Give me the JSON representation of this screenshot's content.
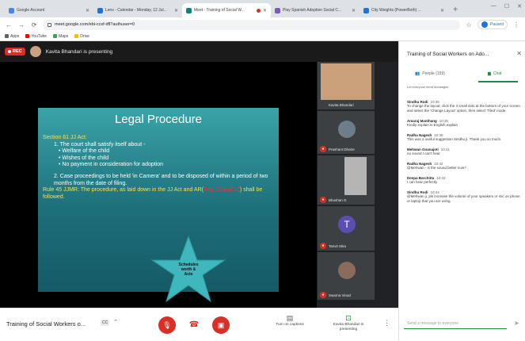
{
  "browser": {
    "tabs": [
      {
        "title": "Google Account",
        "color": "#4285f4",
        "active": false
      },
      {
        "title": "Lens - Calendar - Monday, 12 Jul...",
        "color": "#1a73e8",
        "active": false
      },
      {
        "title": "Meet - Training of Social W...",
        "color": "#00897b",
        "active": true
      },
      {
        "title": "Play Spanish Adoption Social C...",
        "color": "#7e57c2",
        "active": false
      },
      {
        "title": "City Weights (PowerBoth) ...",
        "color": "#1a73e8",
        "active": false
      }
    ],
    "url": "meet.google.com/ebi-ccsf-dfl?authuser=0",
    "paused_label": "Paused",
    "bookmarks": [
      {
        "label": "Apps",
        "color": "#5f6368"
      },
      {
        "label": "YouTube",
        "color": "#ff0000"
      },
      {
        "label": "Maps",
        "color": "#34a853"
      },
      {
        "label": "Drive",
        "color": "#fbbc04"
      }
    ]
  },
  "meet": {
    "rec_label": "REC",
    "presenting_text": "Kavita Bhandari is presenting",
    "slide": {
      "title": "Legal Procedure",
      "lines": [
        {
          "text": "Section 61 JJ Act:",
          "style": "yl"
        },
        {
          "text": "1. The court shall satisfy itself about -",
          "style": "ind1"
        },
        {
          "text": "• Welfare of the child",
          "style": "ind2"
        },
        {
          "text": "• Wishes of the child",
          "style": "ind2"
        },
        {
          "text": "• No payment in consideration for adoption",
          "style": "ind2"
        },
        {
          "text": "",
          "style": "gap"
        },
        {
          "text": "2. Case proceedings to be held 'in Camera' and to be disposed of within a period of two months from the date of filing.",
          "style": "ind1"
        }
      ],
      "rule_line_a": "Rule 45 JJMR: The procedure, as laid down in the JJ Act and AR(",
      "rule_line_reg": "Reg 12 and 17",
      "rule_line_b": ") shall be followed.",
      "star_text": "Schedules worth & Acts"
    },
    "participants": [
      {
        "name": "Kavita Bhandari",
        "muted": false,
        "kind": "photo",
        "color": "#caa07a"
      },
      {
        "name": "Prashant Dhotre",
        "muted": true,
        "kind": "avatar",
        "color": "#6d7d8a"
      },
      {
        "name": "Bhushan G",
        "muted": true,
        "kind": "photo",
        "color": "#b5b5b5"
      },
      {
        "name": "Tanvir Mira",
        "muted": true,
        "kind": "letter",
        "letter": "T",
        "color": "#5c4db1"
      },
      {
        "name": "Swarna Vinod",
        "muted": true,
        "kind": "avatar",
        "color": "#8a6a5a"
      }
    ],
    "meeting_title": "Training of Social Workers o...",
    "meeting_code_badge": "CC",
    "controls": {
      "captions_label": "Turn on captions",
      "presenting_label": "Kavita Bhandari is presenting"
    }
  },
  "panel": {
    "title": "Training of Social Workers on Ado...",
    "tab_people": "People (159)",
    "tab_chat": "Chat",
    "permission_note": "Let everyone send messages",
    "messages": [
      {
        "who": "Sindhu Rodi",
        "time": "10:36",
        "text": "To change the layout, click the 3 small dots at the bottom of your screen and select the 'Change Layout' option, then select 'Tiled' mode."
      },
      {
        "who": "Amaraj Manthang",
        "time": "10:36",
        "text": "Kindly explain in English explain"
      },
      {
        "who": "Radha Nagesh",
        "time": "10:38",
        "text": "This was a useful suggestion Sindhu ji. Thank you so much."
      },
      {
        "who": "Mehwan Gnanajoti",
        "time": "10:41",
        "text": "no sound I can't hear"
      },
      {
        "who": "Radha Nagesh",
        "time": "10:42",
        "text": "@Mehwan - is the sound better now?"
      },
      {
        "who": "Deepa Barchitta",
        "time": "10:43",
        "text": "I can hear perfectly"
      },
      {
        "who": "Sindhu Rodi",
        "time": "10:44",
        "text": "@Mehwan ji, pls increase the volume of your speakers or mic on phone or laptop that you are using."
      }
    ],
    "send_placeholder": "Send a message to everyone"
  }
}
